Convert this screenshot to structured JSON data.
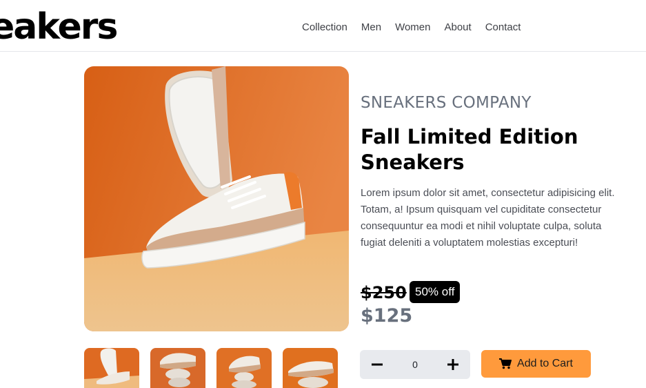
{
  "header": {
    "logo": "eakers",
    "nav": [
      "Collection",
      "Men",
      "Women",
      "About",
      "Contact"
    ]
  },
  "product": {
    "company": "SNEAKERS COMPANY",
    "title": "Fall Limited Edition Sneakers",
    "description": "Lorem ipsum dolor sit amet, consectetur adipisicing elit. Totam, a! Ipsum quisquam vel cupiditate consectetur consequuntur ea modi et nihil voluptate culpa, soluta fugiat deleniti a voluptatem molestias excepturi!",
    "old_price": "$250",
    "discount": "50% off",
    "price": "$125"
  },
  "cart": {
    "quantity": "0",
    "add_label": "Add to Cart"
  },
  "icons": {
    "minus": "minus-icon",
    "plus": "plus-icon",
    "cart": "cart-icon"
  },
  "colors": {
    "accent": "#ff9a3c",
    "muted": "#68707d",
    "image_orange": "#e06a1c",
    "image_floor": "#edb677"
  }
}
